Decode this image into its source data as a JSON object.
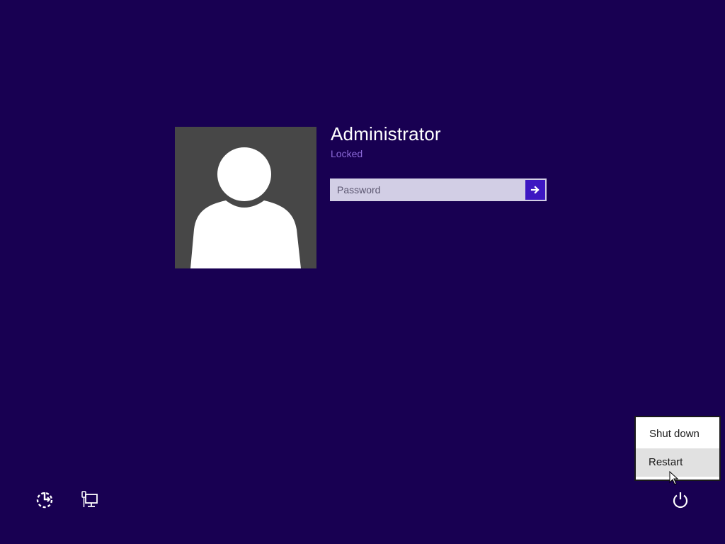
{
  "user": {
    "name": "Administrator",
    "status": "Locked"
  },
  "password": {
    "placeholder": "Password",
    "value": ""
  },
  "power_menu": {
    "items": [
      {
        "label": "Shut down"
      },
      {
        "label": "Restart"
      }
    ]
  },
  "icons": {
    "ease_of_access": "ease-of-access-icon",
    "network": "network-icon",
    "power": "power-icon",
    "submit": "arrow-right-icon"
  },
  "colors": {
    "background": "#180052",
    "avatar_bg": "#474747",
    "status_text": "#8c6ad9",
    "password_bg": "#d2cee5",
    "accent": "#3d17c2",
    "menu_bg": "#ffffff",
    "menu_hover": "#e1e1e1"
  }
}
